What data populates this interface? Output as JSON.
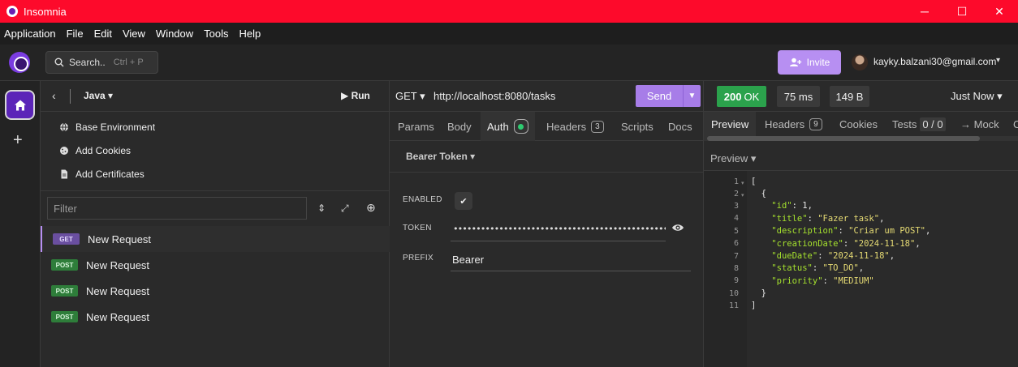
{
  "titlebar": {
    "title": "Insomnia",
    "minimize_glyph": "─",
    "maximize_glyph": "☐",
    "close_glyph": "✕"
  },
  "menu": [
    "Application",
    "File",
    "Edit",
    "View",
    "Window",
    "Tools",
    "Help"
  ],
  "toolbar": {
    "search_label": "Search..",
    "search_shortcut": "Ctrl + P",
    "invite_label": "Invite",
    "user_email": "kayky.balzani30@gmail.com",
    "user_chevron": "▾"
  },
  "rail": {
    "add_glyph": "+"
  },
  "sidebar": {
    "back_glyph": "‹",
    "workspace": "Java ▾",
    "run_label": "▶ Run",
    "links": [
      "Base Environment",
      "Add Cookies",
      "Add Certificates"
    ],
    "filter_placeholder": "Filter",
    "sort_glyph": "⇕",
    "expand_glyph": "⤢",
    "add_glyph": "⊕",
    "requests": [
      {
        "method": "GET",
        "name": "New Request"
      },
      {
        "method": "POST",
        "name": "New Request"
      },
      {
        "method": "POST",
        "name": "New Request"
      },
      {
        "method": "POST",
        "name": "New Request"
      }
    ]
  },
  "request": {
    "method": "GET ▾",
    "url": "http://localhost:8080/tasks",
    "send_label": "Send",
    "send_dropdown": "▼",
    "tabs": {
      "params": "Params",
      "body": "Body",
      "auth": "Auth",
      "headers": "Headers",
      "headers_count": "3",
      "scripts": "Scripts",
      "docs": "Docs"
    },
    "auth_type": "Bearer Token ▾",
    "fields": {
      "enabled_label": "ENABLED",
      "enabled_check": "✔",
      "token_label": "TOKEN",
      "token_value": "••••••••••••••••••••••••••••••••••••••••••••••••••••••••••••••••",
      "prefix_label": "PREFIX",
      "prefix_value": "Bearer"
    }
  },
  "response": {
    "status_code": "200",
    "status_text": "OK",
    "time": "75 ms",
    "size": "149 B",
    "timestamp": "Just Now ▾",
    "tabs": {
      "preview": "Preview",
      "headers": "Headers",
      "headers_count": "9",
      "cookies": "Cookies",
      "tests": "Tests",
      "tests_count": "0 / 0",
      "mock": "→ Mock",
      "cut_tab": "C"
    },
    "preview_mode": "Preview ▾",
    "line_numbers": [
      "1",
      "2",
      "3",
      "4",
      "5",
      "6",
      "7",
      "8",
      "9",
      "10",
      "11"
    ],
    "fold_glyph": "▾",
    "code": {
      "l1": "[",
      "l2": "  {",
      "l3_key": "\"id\"",
      "l3_val": "1",
      "l4_key": "\"title\"",
      "l4_val": "\"Fazer task\"",
      "l5_key": "\"description\"",
      "l5_val": "\"Criar um POST\"",
      "l6_key": "\"creationDate\"",
      "l6_val": "\"2024-11-18\"",
      "l7_key": "\"dueDate\"",
      "l7_val": "\"2024-11-18\"",
      "l8_key": "\"status\"",
      "l8_val": "\"TO_DO\"",
      "l9_key": "\"priority\"",
      "l9_val": "\"MEDIUM\"",
      "l10": "  }",
      "l11": "]"
    }
  },
  "colors": {
    "titlebar": "#fd0a2b",
    "accent": "#a77de8",
    "status_ok": "#2ba24c",
    "json_key": "#a6e22e",
    "json_string": "#e6db74"
  }
}
